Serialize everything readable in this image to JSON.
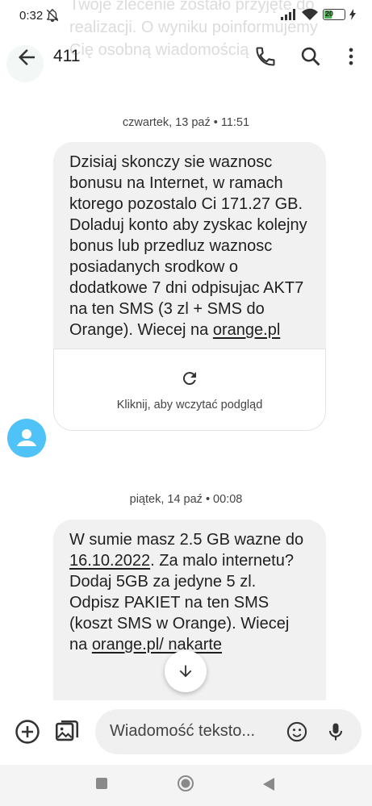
{
  "status_bar": {
    "time": "0:32",
    "battery": "20"
  },
  "background_notification": "Twoje zlecenie zostało przyjęte do realizacji. O wyniku poinformujemy Cię osobną wiadomością",
  "app_bar": {
    "title": "411"
  },
  "messages": [
    {
      "date": "czwartek, 13 paź • 11:51",
      "text_parts": [
        "Dzisiaj skonczy sie waznosc bonusu na Internet, w ramach ktorego pozostalo Ci 171.27 GB. Doladuj konto aby zyskac kolejny bonus lub przedluz waznosc posiadanych srodkow o dodatkowe 7 dni odpisujac AKT7 na ten SMS (3 zl + SMS do Orange). Wiecej na ",
        "orange.pl"
      ],
      "preview_text": "Kliknij, aby wczytać podgląd"
    },
    {
      "date": "piątek, 14 paź • 00:08",
      "text_parts": [
        "W sumie masz 2.5 GB wazne do ",
        "16.10.2022",
        ". Za malo internetu? Dodaj 5GB za jedyne 5 zl. Odpisz PAKIET na ten SMS (koszt SMS w Orange). Wiecej na ",
        "orange.pl/ nakarte"
      ]
    }
  ],
  "compose": {
    "placeholder": "Wiadomość teksto..."
  },
  "icons": {
    "back": "arrow-left-icon",
    "call": "phone-icon",
    "search": "search-icon",
    "more": "more-vert-icon",
    "refresh": "refresh-icon",
    "add": "add-circle-icon",
    "gallery": "gallery-icon",
    "emoji": "emoji-icon",
    "mic": "mic-icon",
    "scroll_down": "arrow-down-icon"
  },
  "colors": {
    "accent": "#4fc3f7",
    "bubble": "#f1f1f1",
    "battery": "#4caf50"
  }
}
